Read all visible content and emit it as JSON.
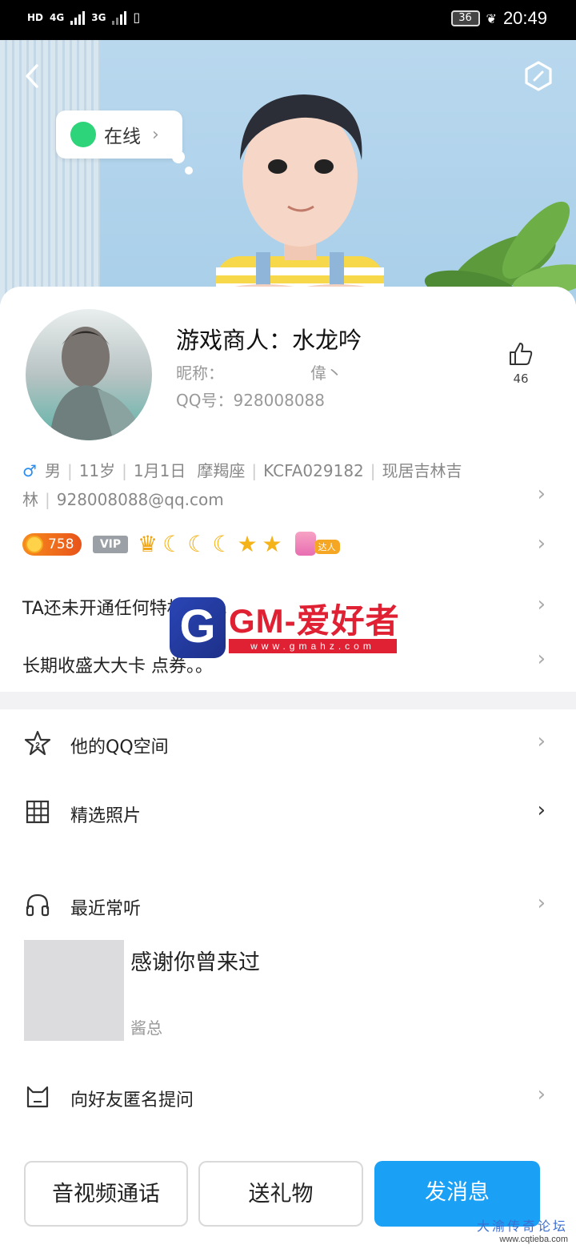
{
  "status_bar": {
    "left_labels": [
      "HD",
      "4G",
      "3G"
    ],
    "battery": "36",
    "time": "20:49"
  },
  "banner": {
    "online_status": "在线"
  },
  "profile": {
    "name": "游戏商人：水龙吟",
    "nickname_label": "昵称：",
    "nickname_value": "偉丶",
    "qq_label": "QQ号：",
    "qq_value": "928008088",
    "likes": "46",
    "gender_symbol": "♂",
    "gender": "男",
    "age": "11岁",
    "birthday": "1月1日",
    "zodiac": "摩羯座",
    "code": "KCFA029182",
    "residence_line1": "现居吉林吉",
    "residence_line2": "林",
    "email": "928008088@qq.com"
  },
  "badges": {
    "coins": "758",
    "vip": "VIP",
    "daren": "达人",
    "icons": [
      "crown-icon",
      "moon-icon",
      "moon-icon",
      "moon-icon",
      "star-icon",
      "star-icon"
    ]
  },
  "services": {
    "ta_text": "TA还未开通任何特权服务。",
    "card_text": "长期收盛大大卡 点券。。"
  },
  "watermark": {
    "letter": "G",
    "title": "GM-爱好者",
    "url": "www.gmahz.com"
  },
  "menu": {
    "qzone": "他的QQ空间",
    "photos": "精选照片",
    "music": "最近常听",
    "anon": "向好友匿名提问"
  },
  "music": {
    "song_title": "感谢你曾来过",
    "artist": "酱总"
  },
  "buttons": {
    "call": "音视频通话",
    "gift": "送礼物",
    "message": "发消息"
  },
  "forum_watermark": {
    "name": "大渝传奇论坛",
    "url": "www.cqtieba.com"
  },
  "colors": {
    "accent_blue": "#1aa0f5",
    "online_green": "#2ed47a",
    "coin_orange": "#f78c1e",
    "watermark_red": "#e02033"
  }
}
